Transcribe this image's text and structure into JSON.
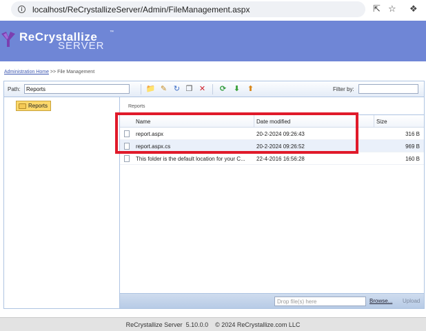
{
  "browser": {
    "url": "localhost/ReCrystallizeServer/Admin/FileManagement.aspx",
    "icons": [
      "info-icon",
      "share-icon",
      "star-icon",
      "extension-icon"
    ]
  },
  "banner": {
    "logo_line1": "ReCrystallize",
    "logo_line2": "SERVER",
    "logo_tm": "™",
    "background": "#6f86d6"
  },
  "breadcrumb": {
    "home_link": "Administration Home",
    "separator": ">>",
    "current": "File Management"
  },
  "toolbar": {
    "path_label": "Path:",
    "path_value": "Reports",
    "filter_label": "Filter by:",
    "filter_value": "",
    "buttons": [
      "new-folder-icon",
      "rename-icon",
      "refresh-icon",
      "copy-icon",
      "delete-icon",
      "reload-icon",
      "download-icon",
      "upload-icon"
    ]
  },
  "tree": {
    "selected_folder": "Reports"
  },
  "grid": {
    "current_path": "Reports",
    "columns": [
      "Name",
      "Date modified",
      "Size"
    ],
    "rows": [
      {
        "name": "report.aspx",
        "date": "20-2-2024 09:26:43",
        "size": "316 B"
      },
      {
        "name": "report.aspx.cs",
        "date": "20-2-2024 09:26:52",
        "size": "969 B"
      },
      {
        "name": "This folder is the default location for your C...",
        "date": "22-4-2016 16:56:28",
        "size": "160 B"
      }
    ]
  },
  "upload_bar": {
    "drop_placeholder": "Drop file(s) here",
    "browse_label": "Browse...",
    "upload_label": "Upload"
  },
  "footer": {
    "text": "ReCrystallize Server  5.10.0.0    © 2024 ReCrystallize.com LLC"
  },
  "colors": {
    "highlight": "#e01a2a",
    "selected_folder": "#fbd86b"
  }
}
